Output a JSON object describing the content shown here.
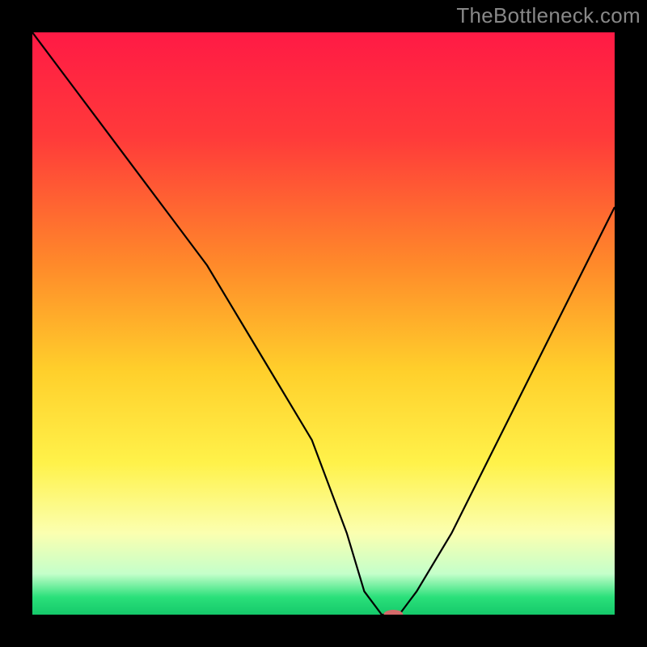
{
  "watermark": "TheBottleneck.com",
  "chart_data": {
    "type": "line",
    "title": "",
    "xlabel": "",
    "ylabel": "",
    "xlim": [
      0,
      100
    ],
    "ylim": [
      0,
      100
    ],
    "background_gradient": {
      "stops": [
        {
          "pct": 0,
          "color": "#ff1a45"
        },
        {
          "pct": 18,
          "color": "#ff3a3a"
        },
        {
          "pct": 40,
          "color": "#ff8a2a"
        },
        {
          "pct": 58,
          "color": "#ffcf2b"
        },
        {
          "pct": 74,
          "color": "#fff24a"
        },
        {
          "pct": 86,
          "color": "#fbffb0"
        },
        {
          "pct": 93,
          "color": "#c4ffca"
        },
        {
          "pct": 97,
          "color": "#2ae07a"
        },
        {
          "pct": 100,
          "color": "#15c96a"
        }
      ]
    },
    "series": [
      {
        "name": "bottleneck-curve",
        "color": "#000000",
        "width": 2.2,
        "x": [
          0,
          6,
          12,
          18,
          24,
          30,
          36,
          42,
          48,
          54,
          57,
          60,
          63,
          66,
          72,
          78,
          84,
          90,
          96,
          100
        ],
        "y": [
          100,
          92,
          84,
          76,
          68,
          60,
          50,
          40,
          30,
          14,
          4,
          0,
          0,
          4,
          14,
          26,
          38,
          50,
          62,
          70
        ]
      }
    ],
    "marker": {
      "name": "minimum-marker",
      "x": 62,
      "y": 0,
      "color": "#d46a6a",
      "rx": 12,
      "ry": 6
    }
  }
}
